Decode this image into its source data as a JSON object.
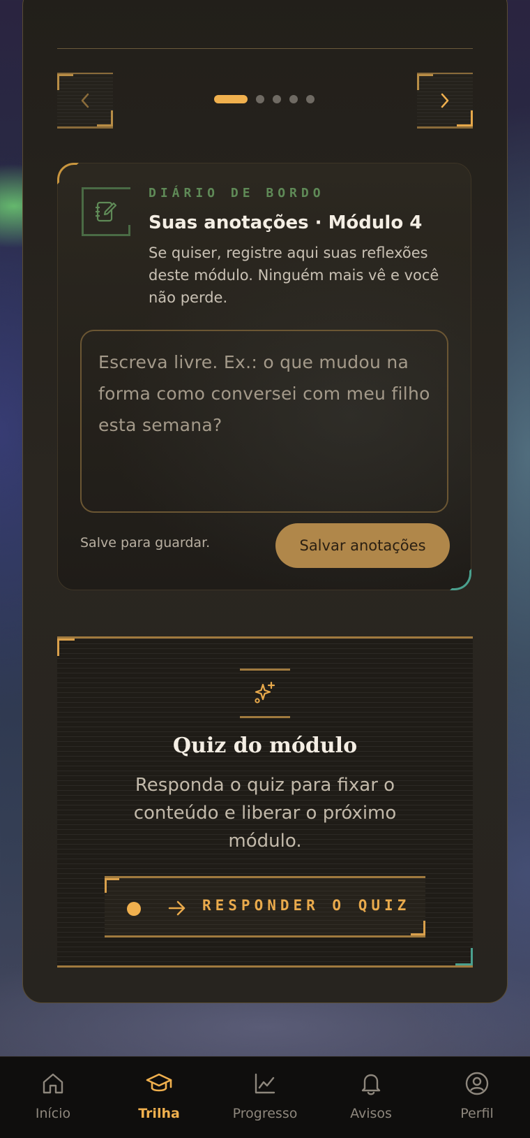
{
  "carousel": {
    "prev_icon": "chevron-left-icon",
    "next_icon": "chevron-right-icon",
    "dots_total": 5,
    "active_index": 0
  },
  "diary": {
    "icon": "notebook-pen-icon",
    "eyebrow": "DIÁRIO DE BORDO",
    "title": "Suas anotações · Módulo 4",
    "description": "Se quiser, registre aqui suas reflexões deste módulo. Ninguém mais vê e você não perde.",
    "textarea_placeholder": "Escreva livre. Ex.: o que mudou na forma como conversei com meu filho esta semana?",
    "hint": "Salve para guardar.",
    "save_label": "Salvar anotações"
  },
  "quiz": {
    "icon": "sparkles-icon",
    "title": "Quiz do módulo",
    "description": "Responda o quiz para fixar o conteúdo e liberar o próximo módulo.",
    "button_label": "RESPONDER O QUIZ"
  },
  "bottom_nav": {
    "items": [
      {
        "label": "Início",
        "icon": "home-icon"
      },
      {
        "label": "Trilha",
        "icon": "graduation-cap-icon",
        "active": true
      },
      {
        "label": "Progresso",
        "icon": "chart-line-icon"
      },
      {
        "label": "Avisos",
        "icon": "bell-icon"
      },
      {
        "label": "Perfil",
        "icon": "user-circle-icon"
      }
    ]
  },
  "colors": {
    "accent": "#f0b04e",
    "teal_accent": "#4aa08e",
    "green_label": "#5f8a57"
  }
}
